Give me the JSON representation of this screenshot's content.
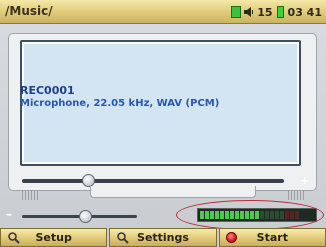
{
  "header": {
    "title": "/Music/",
    "volume": "15",
    "time": "03 41"
  },
  "file": {
    "name": "REC0001",
    "info": "Microphone, 22.05 kHz, WAV (PCM)"
  },
  "progress": {
    "position": 0.25
  },
  "volume_slider": {
    "position": 0.55
  },
  "level_meter": {
    "segments": 20,
    "lit": 12
  },
  "softkeys": {
    "setup": "Setup",
    "settings": "Settings",
    "start": "Start"
  },
  "colors": {
    "accent_yellow": "#e0c977",
    "screen_blue": "#d3e4f3",
    "text_blue": "#1d3f8f",
    "record_red": "#e01818",
    "meter_green": "#4ec84e"
  }
}
